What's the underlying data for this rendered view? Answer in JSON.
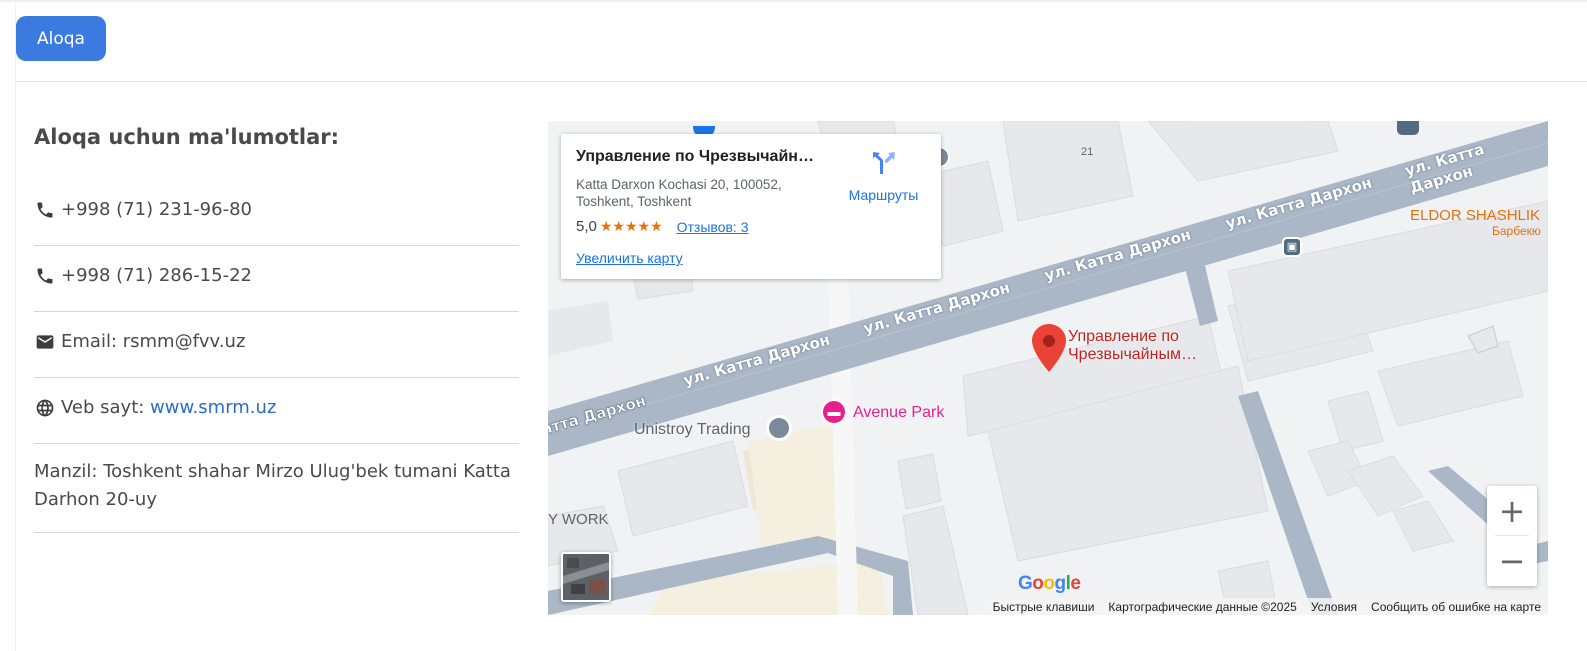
{
  "header": {
    "tab_label": "Aloqa"
  },
  "contact": {
    "title": "Aloqa uchun ma'lumotlar:",
    "phone1": "+998 (71) 231-96-80",
    "phone2": "+998 (71) 286-15-22",
    "email": "Email: rsmm@fvv.uz",
    "website_prefix": "Veb sayt: ",
    "website_link": "www.smrm.uz",
    "address": "Manzil: Toshkent shahar Mirzo Ulug'bek tumani Katta Darhon 20-uy"
  },
  "map": {
    "card": {
      "title": "Управление по Чрезвычайным ситуациям",
      "address": "Katta Darxon Kochasi 20, 100052, Toshkent, Toshkent",
      "rating": "5,0",
      "stars": "★★★★★",
      "reviews": "Отзывов: 3",
      "enlarge": "Увеличить карту",
      "directions": "Маршруты"
    },
    "street_label": "ул. Катта Дархон",
    "street_label_cut": "атта Дархон",
    "marker_label_1": "Управление по",
    "marker_label_2": "Чрезвычайным…",
    "poi_avenue": "Avenue Park",
    "poi_unistroy": "Unistroy Trading",
    "poi_eldor": "ELDOR SHASHLIK",
    "poi_eldor_sub": "Барбекю",
    "poi_work": "Y WORK",
    "building_number": "21",
    "zoom_in": "+",
    "zoom_out": "−",
    "google": "Google",
    "footer": {
      "shortcuts": "Быстрые клавиши",
      "data": "Картографические данные ©2025",
      "terms": "Условия",
      "report": "Сообщить об ошибке на карте"
    }
  },
  "colors": {
    "accent": "#3b7be0",
    "link": "#2b6bd0",
    "road": "#a9b7c7",
    "marker": "#ea4335",
    "poi_pink": "#e61f8c",
    "poi_orange": "#e8710a"
  },
  "icons": [
    "phone-icon",
    "email-icon",
    "globe-icon",
    "directions-icon",
    "map-marker-icon",
    "bus-stop-icon",
    "hotel-icon",
    "place-icon"
  ]
}
